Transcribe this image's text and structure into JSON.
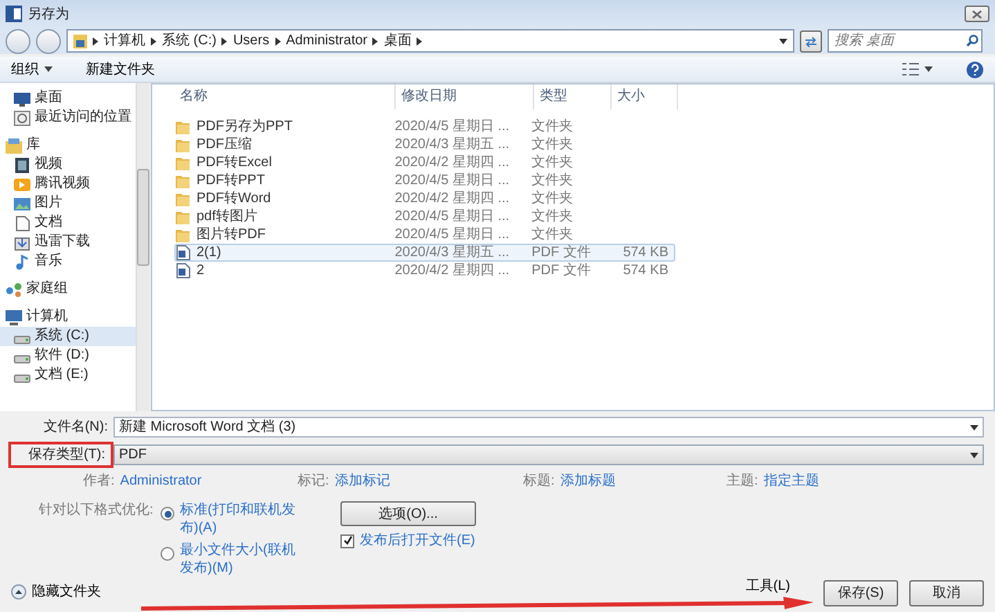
{
  "window": {
    "title": "另存为"
  },
  "breadcrumb": [
    "计算机",
    "系统 (C:)",
    "Users",
    "Administrator",
    "桌面"
  ],
  "search": {
    "placeholder": "搜索 桌面"
  },
  "toolbar": {
    "organize": "组织",
    "new_folder": "新建文件夹"
  },
  "sidebar": {
    "items": [
      {
        "kind": "item",
        "label": "桌面",
        "selected": false
      },
      {
        "kind": "item",
        "label": "最近访问的位置",
        "selected": false
      },
      {
        "kind": "header",
        "label": "库",
        "selected": false,
        "children": [
          {
            "label": "视频",
            "selected": false
          },
          {
            "label": "腾讯视频",
            "selected": false
          },
          {
            "label": "图片",
            "selected": false
          },
          {
            "label": "文档",
            "selected": false
          },
          {
            "label": "迅雷下载",
            "selected": false
          },
          {
            "label": "音乐",
            "selected": false
          }
        ]
      },
      {
        "kind": "header",
        "label": "家庭组",
        "selected": false
      },
      {
        "kind": "header",
        "label": "计算机",
        "selected": false,
        "children": [
          {
            "label": "系统 (C:)",
            "selected": true
          },
          {
            "label": "软件 (D:)",
            "selected": false
          },
          {
            "label": "文档 (E:)",
            "selected": false
          }
        ]
      }
    ]
  },
  "table": {
    "columns": [
      "名称",
      "修改日期",
      "类型",
      "大小"
    ],
    "rows": [
      {
        "kind": "folder",
        "name": "PDF另存为PPT",
        "date": "2020/4/5 星期日 ...",
        "type": "文件夹",
        "selected": false
      },
      {
        "kind": "folder",
        "name": "PDF压缩",
        "date": "2020/4/3 星期五 ...",
        "type": "文件夹",
        "selected": false
      },
      {
        "kind": "folder",
        "name": "PDF转Excel",
        "date": "2020/4/2 星期四 ...",
        "type": "文件夹",
        "selected": false
      },
      {
        "kind": "folder",
        "name": "PDF转PPT",
        "date": "2020/4/5 星期日 ...",
        "type": "文件夹",
        "selected": false
      },
      {
        "kind": "folder",
        "name": "PDF转Word",
        "date": "2020/4/2 星期四 ...",
        "type": "文件夹",
        "selected": false
      },
      {
        "kind": "folder",
        "name": "pdf转图片",
        "date": "2020/4/5 星期日 ...",
        "type": "文件夹",
        "selected": false
      },
      {
        "kind": "folder",
        "name": "图片转PDF",
        "date": "2020/4/5 星期日 ...",
        "type": "文件夹",
        "selected": false
      },
      {
        "kind": "file",
        "name": "2(1)",
        "date": "2020/4/3 星期五 ...",
        "type": "PDF 文件",
        "size": "574 KB",
        "selected": true
      },
      {
        "kind": "file",
        "name": "2",
        "date": "2020/4/2 星期四 ...",
        "type": "PDF 文件",
        "size": "574 KB",
        "selected": false
      }
    ]
  },
  "form": {
    "filename": {
      "label": "文件名(N):",
      "value": "新建 Microsoft Word 文档 (3)"
    },
    "save_type": {
      "label": "保存类型(T):",
      "value": "PDF",
      "highlighted": true
    },
    "meta": [
      {
        "label": "作者:",
        "value": "Administrator"
      },
      {
        "label": "标记:",
        "value": "添加标记"
      },
      {
        "label": "标题:",
        "value": "添加标题"
      },
      {
        "label": "主题:",
        "value": "指定主题"
      }
    ],
    "optimize": {
      "label": "针对以下格式优化:",
      "options": [
        {
          "label": "标准(打印和联机发布)(A)",
          "selected": true
        },
        {
          "label": "最小文件大小(联机发布)(M)",
          "selected": false
        }
      ]
    },
    "options_button": "选项(O)...",
    "open_after": {
      "label": "发布后打开文件(E)",
      "checked": true
    }
  },
  "footer": {
    "hide_folders": "隐藏文件夹",
    "tools": "工具(L)",
    "save": "保存(S)",
    "cancel": "取消"
  }
}
